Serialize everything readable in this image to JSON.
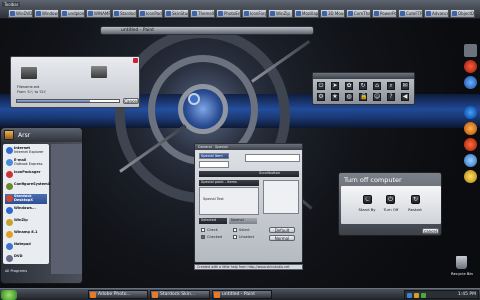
{
  "toolbar": {
    "label": "Toolbar",
    "items": [
      "WinDVD",
      "Windows",
      "undplomer",
      "WINAMP",
      "Stardock D...",
      "IconPackager",
      "SkinStudio",
      "ThemeXP",
      "PhotoEngin...",
      "IconForge",
      "WinZip",
      "Mozillapgnp",
      "3D Mouse",
      "ComThanks ...",
      "PowerPoint",
      "CuteFTPro",
      "Advanced",
      "ObjectDock"
    ]
  },
  "center_window_title": "untitled - Paint",
  "copy_dialog": {
    "line1": "Filename.ext",
    "line2": "From 'C:\\' to 'D:\\'",
    "progress": 0.72,
    "cancel_label": "Cancel"
  },
  "icon_panel": {
    "icons": [
      "power-icon",
      "pointer-icon",
      "flower-icon",
      "refresh-icon",
      "house-icon",
      "search-icon",
      "mail-icon",
      "gear-icon",
      "star-icon",
      "globe-icon",
      "lock-icon",
      "user-icon",
      "help-icon",
      "back-icon"
    ]
  },
  "start_menu": {
    "user": "Arsr",
    "items": [
      {
        "title": "Internet",
        "sub": "Internet Explorer",
        "color": "#2f6fd0"
      },
      {
        "title": "E-mail",
        "sub": "Outlook Express",
        "color": "#4a8bd8"
      },
      {
        "title": "IconPackager",
        "sub": "",
        "color": "#c33"
      },
      {
        "title": "ConfigureSystemXP",
        "sub": "",
        "color": "#6a8a2a"
      },
      {
        "title": "Stardock DesktopX",
        "sub": "",
        "color": "#d5462a"
      },
      {
        "title": "Windows...",
        "sub": "",
        "color": "#2a6ad0"
      },
      {
        "title": "WinZip",
        "sub": "",
        "color": "#c9a22a"
      },
      {
        "title": "Winamp 8.1",
        "sub": "",
        "color": "#e0a020"
      },
      {
        "title": "Notepad",
        "sub": "",
        "color": "#3a76c8"
      },
      {
        "title": "DVD",
        "sub": "",
        "color": "#6a6a8a"
      }
    ],
    "all_programs": "All Programs"
  },
  "properties": {
    "tabs": [
      "General",
      "Special"
    ],
    "item_label": "Special Item",
    "fieldset": "Special point - items",
    "special_text": "Special Text",
    "list_label": "List",
    "slider_label": "Scrollbutton",
    "sub_tabs": [
      "Selected",
      "Normal"
    ],
    "checks": [
      "Check",
      "Select",
      "Checked",
      "Unselect"
    ],
    "buttons": [
      "Default",
      "Normal"
    ],
    "status": "Created with a little help from http://www.skinstudio.net"
  },
  "turnoff": {
    "title": "Turn off computer",
    "buttons": [
      "Stand By",
      "Turn Off",
      "Restart"
    ],
    "cancel_label": "cancel"
  },
  "recycle_bin": "Recycle Bin",
  "taskbar": {
    "items": [
      "Adobe Photo...",
      "Stardock Skin...",
      "untitled - Paint"
    ],
    "clock": "1:45 PM"
  }
}
